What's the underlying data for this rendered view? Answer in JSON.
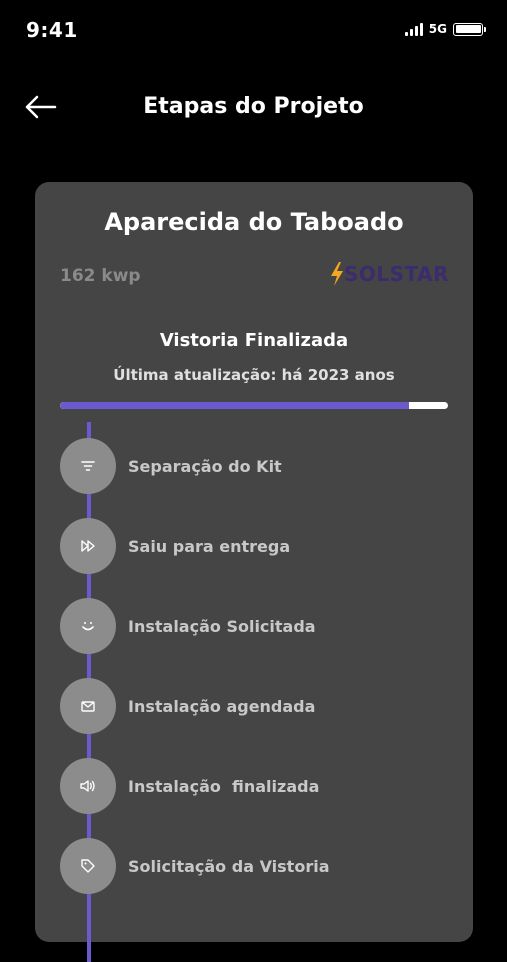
{
  "status_bar": {
    "time": "9:41",
    "network": "5G"
  },
  "header": {
    "title": "Etapas do Projeto"
  },
  "card": {
    "project_name": "Aparecida do Taboado",
    "power": "162 kwp",
    "logo_text": "SOLSTAR",
    "stage_title": "Vistoria Finalizada",
    "last_update": "Última atualização: há 2023 anos",
    "progress": 0.9
  },
  "steps": [
    {
      "label": "Separação do Kit",
      "icon": "filter-icon"
    },
    {
      "label": "Saiu para entrega",
      "icon": "fast-forward-icon"
    },
    {
      "label": "Instalação Solicitada",
      "icon": "smile-icon"
    },
    {
      "label": "Instalação agendada",
      "icon": "mail-icon"
    },
    {
      "label": "Instalação  finalizada",
      "icon": "speaker-icon"
    },
    {
      "label": "Solicitação da Vistoria",
      "icon": "tag-icon"
    }
  ],
  "colors": {
    "accent": "#6a5acd",
    "card": "#454545",
    "circle": "#8c8c8c",
    "logo": "#3b2c6e",
    "logo_bolt": "#f5a623"
  }
}
